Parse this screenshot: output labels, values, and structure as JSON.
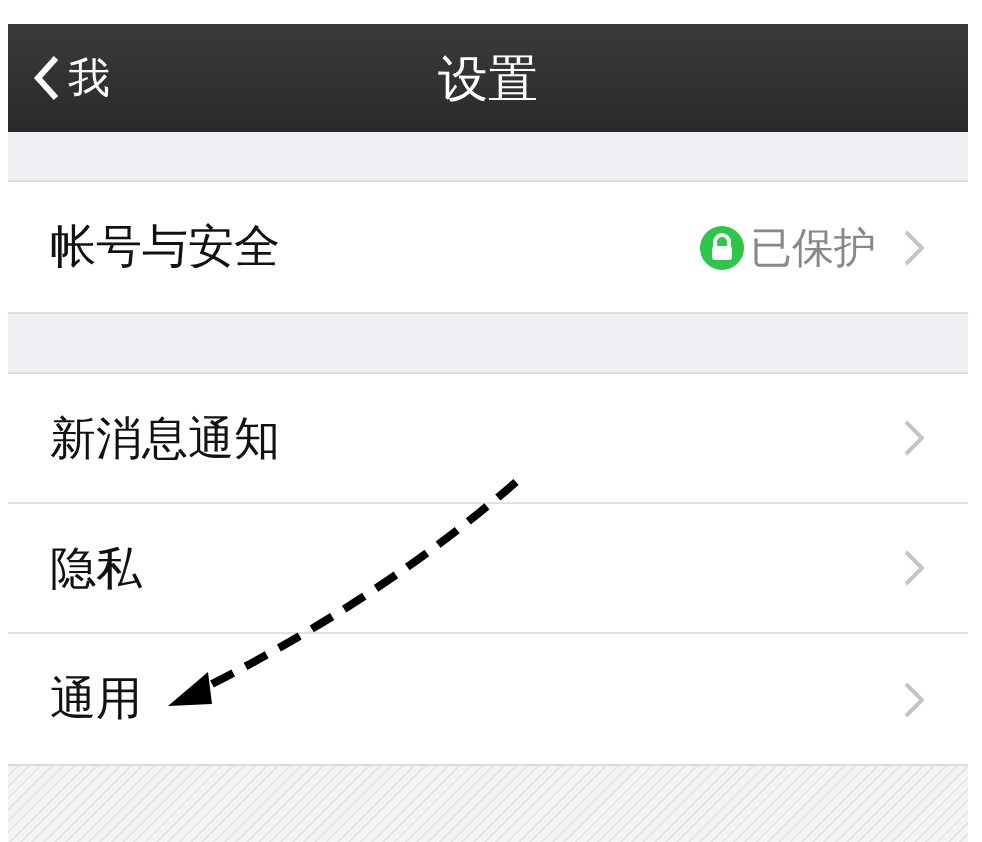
{
  "nav_bar": {
    "back_label": "我",
    "title": "设置"
  },
  "groups": [
    {
      "items": [
        {
          "kind": "status",
          "label": "帐号与安全",
          "value": "已保护"
        }
      ]
    },
    {
      "items": [
        {
          "kind": "plain",
          "label": "新消息通知"
        },
        {
          "kind": "plain",
          "label": "隐私"
        },
        {
          "kind": "plain",
          "label": "通用"
        }
      ]
    }
  ]
}
